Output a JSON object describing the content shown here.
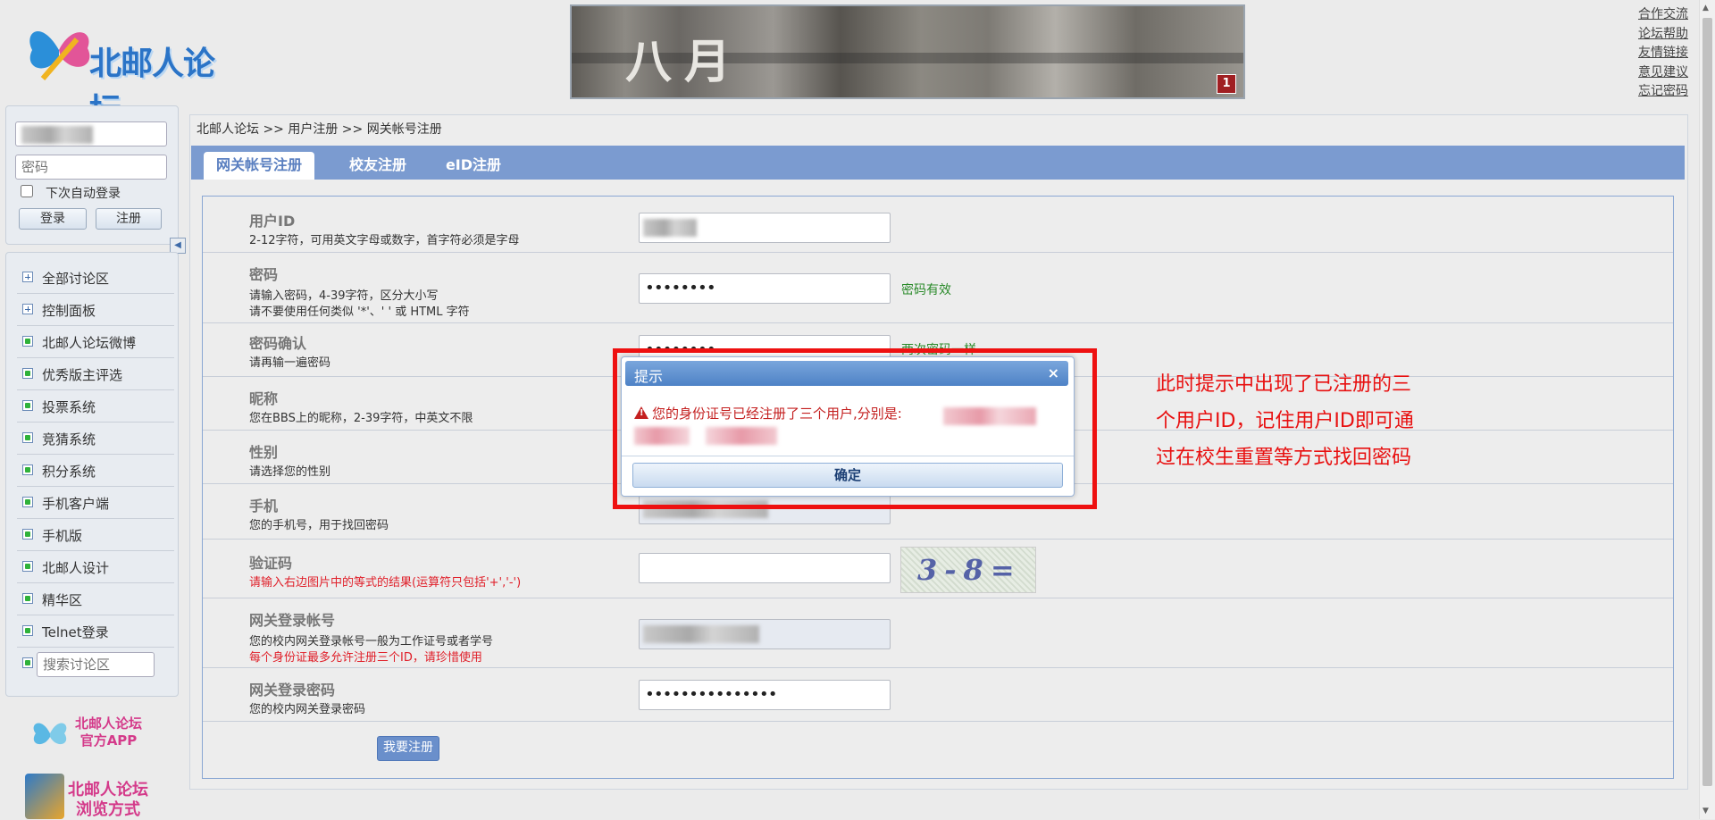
{
  "site": {
    "logo_text": "北邮人论坛"
  },
  "banner": {
    "title": "八月",
    "badge": "1"
  },
  "top_links": [
    "合作交流",
    "论坛帮助",
    "友情链接",
    "意见建议",
    "忘记密码"
  ],
  "login": {
    "password_placeholder": "密码",
    "remember_label": "下次自动登录",
    "login_button": "登录",
    "register_button": "注册"
  },
  "nav": {
    "items": [
      "全部讨论区",
      "控制面板",
      "北邮人论坛微博",
      "优秀版主评选",
      "投票系统",
      "竞猜系统",
      "积分系统",
      "手机客户端",
      "手机版",
      "北邮人设计",
      "精华区",
      "Telnet登录"
    ],
    "search_placeholder": "搜索讨论区"
  },
  "promo": {
    "app": [
      "北邮人论坛",
      "官方APP"
    ],
    "browse": [
      "北邮人论坛",
      "浏览方式"
    ]
  },
  "breadcrumb": "北邮人论坛 >> 用户注册 >> 网关帐号注册",
  "tabs": [
    "网关帐号注册",
    "校友注册",
    "eID注册"
  ],
  "form": {
    "userid": {
      "title": "用户ID",
      "desc": "2-12字符，可用英文字母或数字，首字符必须是字母"
    },
    "password": {
      "title": "密码",
      "desc1": "请输入密码，4-39字符，区分大小写",
      "desc2": "请不要使用任何类似 '*'、' ' 或 HTML 字符",
      "value": "••••••••",
      "status": "密码有效"
    },
    "confirm": {
      "title": "密码确认",
      "desc": "请再输一遍密码",
      "value": "••••••••",
      "status": "两次密码一样"
    },
    "nickname": {
      "title": "昵称",
      "desc": "您在BBS上的昵称，2-39字符，中英文不限"
    },
    "gender": {
      "title": "性别",
      "desc": "请选择您的性别"
    },
    "phone": {
      "title": "手机",
      "desc": "您的手机号，用于找回密码"
    },
    "captcha": {
      "title": "验证码",
      "desc": "请输入右边图片中的等式的结果(运算符只包括'+','-')",
      "image_text": "3-8="
    },
    "gateway_account": {
      "title": "网关登录帐号",
      "desc1": "您的校内网关登录帐号一般为工作证号或者学号",
      "desc2": "每个身份证最多允许注册三个ID，请珍惜使用"
    },
    "gateway_password": {
      "title": "网关登录密码",
      "desc": "您的校内网关登录密码",
      "value": "•••••••••••••••"
    },
    "submit": "我要注册"
  },
  "dialog": {
    "title": "提示",
    "close": "×",
    "message": "您的身份证号已经注册了三个用户,分别是:",
    "ok": "确定"
  },
  "annotation": [
    "此时提示中出现了已注册的三",
    "个用户ID，记住用户ID即可通",
    "过在校生重置等方式找回密码"
  ]
}
